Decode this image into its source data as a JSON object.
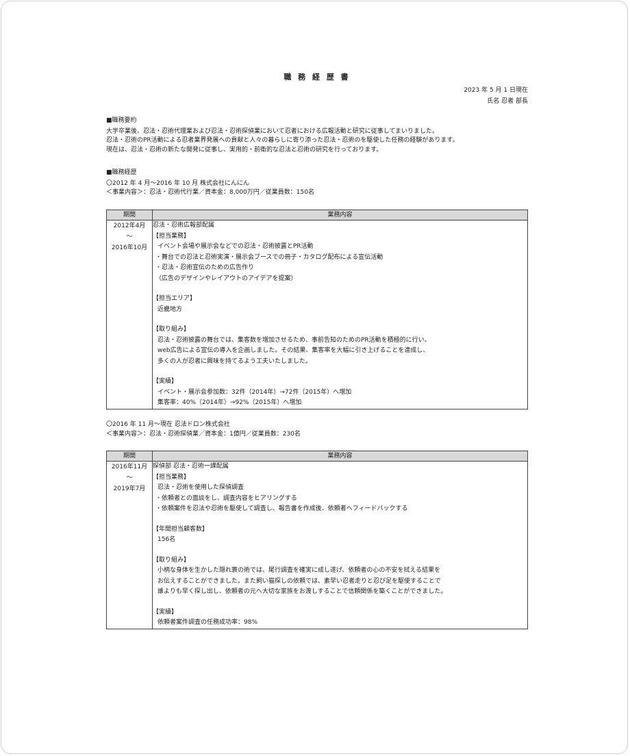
{
  "doc": {
    "title": "職 務 経 歴 書",
    "date": "2023 年 5 月 1 日現在",
    "name": "氏名 忍者 部長"
  },
  "summary": {
    "heading": "■職務要約",
    "lines": [
      "大学卒業後、忍法・忍術代理業および忍法・忍術探偵業において忍者における広報活動と研究に従事してまいりました。",
      "忍法・忍術のPR活動による忍者業界発展への貢献と人々の暮らしに寄り添った忍法・忍術のを駆使した任務の経験があります。",
      "現在は、忍法・忍術の新たな開発に従事し、実用的・前衛的な忍法と忍術の研究を行っております。"
    ]
  },
  "history": {
    "heading": "■職務経歴",
    "col_period": "期間",
    "col_content": "業務内容",
    "companies": [
      {
        "title": "〇2012 年 4 月～2016 年 10 月 株式会社にんにん",
        "business": "＜事業内容＞：忍法・忍術代行業／資本金：8,000万円／従業員数：150名",
        "period_start": "2012年4月",
        "period_sep": "～",
        "period_end": "2016年10月",
        "dept": "忍法・忍術広報部配属",
        "duties_heading": "【担当業務】",
        "duties": [
          "イベント会場や展示会などでの忍法・忍術披露とPR活動",
          "・舞台での忍法と忍術実演・展示会ブースでの冊子・カタログ配布による宣伝活動",
          "・忍法・忍術宣伝のための広告作り",
          "（広告のデザインやレイアウトのアイデアを提案）"
        ],
        "area_heading": "【担当エリア】",
        "area": "近畿地方",
        "effort_heading": "【取り組み】",
        "effort": [
          "忍法・忍術披露の舞台では、集客数を増加させるため、事前告知のためのPR活動を積極的に行い、",
          "web広告による宣伝の導入を企画しました。その結果、集客率を大幅に引き上げることを達成し、",
          "多くの人が忍者に興味を持てるよう工夫いたしました。"
        ],
        "result_heading": "【実績】",
        "results": [
          "イベント・展示会参加数：32件（2014年）→72件（2015年）へ増加",
          "集客率：40%（2014年）→92%（2015年）へ増加"
        ]
      },
      {
        "title": "〇2016 年 11 月～現在 忍法ドロン株式会社",
        "business": "＜事業内容＞：忍法・忍術探偵業／資本金：1億円／従業員数：230名",
        "period_start": "2016年11月",
        "period_sep": "～",
        "period_end": "2019年7月",
        "dept": "探偵部 忍法・忍術一課配属",
        "duties_heading": "【担当業務】",
        "duties": [
          "忍法・忍術を使用した探偵調査",
          "・依頼者との面談をし、調査内容をヒアリングする",
          "・依頼案件を忍法や忍術を駆使して調査し、報告書を作成後、依頼者へフィードバックする"
        ],
        "area_heading": "【年間担当顧客数】",
        "area": "156名",
        "effort_heading": "【取り組み】",
        "effort": [
          "小柄な身体を生かした隠れ蓑の術では、尾行調査を確実に成し遂げ、依頼者の心の不安を拭える結果を",
          "お伝えすることができました。また飼い猫探しの依頼では、素早い忍者走りと忍び足を駆使することで",
          "誰よりも早く探し出し、依頼者の元へ大切な家族をお渡しすることで信頼関係を築くことができました。"
        ],
        "result_heading": "【実績】",
        "results": [
          "依頼者案件調査の任務成功率：98%"
        ]
      }
    ]
  }
}
